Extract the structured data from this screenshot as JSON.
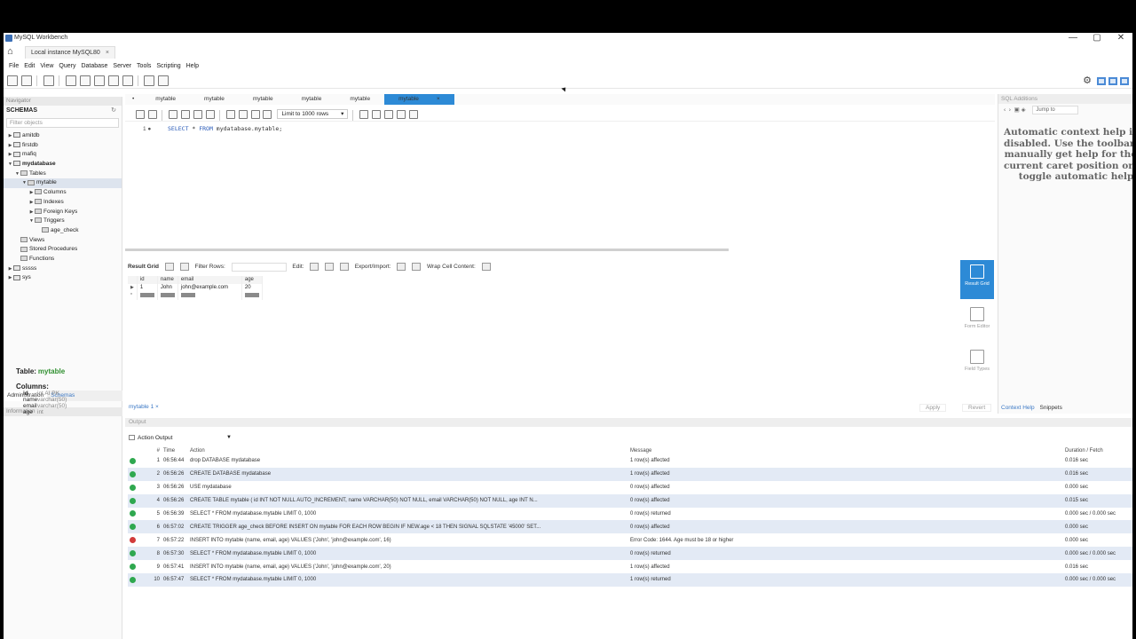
{
  "window": {
    "title": "MySQL Workbench",
    "controls": [
      "—",
      "▢",
      "✕"
    ]
  },
  "connection_tab": {
    "label": "Local instance MySQL80",
    "close": "×"
  },
  "menu": [
    "File",
    "Edit",
    "View",
    "Query",
    "Database",
    "Server",
    "Tools",
    "Scripting",
    "Help"
  ],
  "navigator": {
    "header": "Navigator",
    "schemas_title": "SCHEMAS",
    "refresh": "↻",
    "filter_placeholder": "Filter objects",
    "tree": [
      {
        "label": "amitdb",
        "level": 0,
        "arrow": "▶",
        "bold": false
      },
      {
        "label": "firstdb",
        "level": 0,
        "arrow": "▶",
        "bold": false
      },
      {
        "label": "mafiq",
        "level": 0,
        "arrow": "▶",
        "bold": false
      },
      {
        "label": "mydatabase",
        "level": 0,
        "arrow": "▼",
        "bold": true
      },
      {
        "label": "Tables",
        "level": 1,
        "arrow": "▼",
        "bold": false
      },
      {
        "label": "mytable",
        "level": 2,
        "arrow": "▼",
        "bold": false,
        "selected": true
      },
      {
        "label": "Columns",
        "level": 3,
        "arrow": "▶",
        "bold": false
      },
      {
        "label": "Indexes",
        "level": 3,
        "arrow": "▶",
        "bold": false
      },
      {
        "label": "Foreign Keys",
        "level": 3,
        "arrow": "▶",
        "bold": false
      },
      {
        "label": "Triggers",
        "level": 3,
        "arrow": "▼",
        "bold": false
      },
      {
        "label": "age_check",
        "level": 4,
        "arrow": "",
        "bold": false
      },
      {
        "label": "Views",
        "level": 1,
        "arrow": "",
        "bold": false
      },
      {
        "label": "Stored Procedures",
        "level": 1,
        "arrow": "",
        "bold": false
      },
      {
        "label": "Functions",
        "level": 1,
        "arrow": "",
        "bold": false
      },
      {
        "label": "sssss",
        "level": 0,
        "arrow": "▶",
        "bold": false
      },
      {
        "label": "sys",
        "level": 0,
        "arrow": "▶",
        "bold": false
      }
    ],
    "tabs": [
      "Administration",
      "Schemas"
    ],
    "info_header": "Information",
    "info": {
      "table_label": "Table:",
      "table_name": "mytable",
      "columns_label": "Columns:",
      "columns": [
        {
          "name": "id",
          "type": "int AI PK"
        },
        {
          "name": "name",
          "type": "varchar(50)"
        },
        {
          "name": "email",
          "type": "varchar(50)"
        },
        {
          "name": "age",
          "type": "int"
        }
      ]
    }
  },
  "editor": {
    "tabs": [
      "mytable",
      "mytable",
      "mytable",
      "mytable",
      "mytable",
      "mytable"
    ],
    "active_tab_close": "×",
    "limit": "Limit to 1000 rows",
    "line_no": "1",
    "sql_kw1": "SELECT",
    "sql_mid": " * ",
    "sql_kw2": "FROM",
    "sql_rest": " mydatabase.mytable;"
  },
  "result": {
    "result_grid_label": "Result Grid",
    "filter_rows_label": "Filter Rows:",
    "edit_label": "Edit:",
    "export_label": "Export/Import:",
    "wrap_label": "Wrap Cell Content:",
    "columns": [
      "id",
      "name",
      "email",
      "age"
    ],
    "rows": [
      [
        "1",
        "John",
        "john@example.com",
        "20"
      ]
    ],
    "side_buttons": [
      "Result Grid",
      "Form Editor",
      "Field Types"
    ],
    "bottom_tab": "mytable 1",
    "apply": "Apply",
    "revert": "Revert"
  },
  "additions": {
    "header": "SQL Additions",
    "jump_to": "Jump to",
    "help_lines": [
      "Automatic context help is",
      "disabled. Use the toolbar t",
      "manually get help for the",
      "current caret position or t",
      "toggle automatic help."
    ],
    "tabs": [
      "Context Help",
      "Snippets"
    ]
  },
  "output": {
    "header": "Output",
    "selector": "Action Output",
    "columns": [
      "#",
      "Time",
      "Action",
      "Message",
      "Duration / Fetch"
    ],
    "rows": [
      {
        "status": "ok",
        "num": "1",
        "time": "06:56:44",
        "action": "drop DATABASE mydatabase",
        "message": "1 row(s) affected",
        "duration": "0.016 sec"
      },
      {
        "status": "ok",
        "num": "2",
        "time": "06:56:26",
        "action": "CREATE DATABASE mydatabase",
        "message": "1 row(s) affected",
        "duration": "0.016 sec"
      },
      {
        "status": "ok",
        "num": "3",
        "time": "06:56:26",
        "action": "USE mydatabase",
        "message": "0 row(s) affected",
        "duration": "0.000 sec"
      },
      {
        "status": "ok",
        "num": "4",
        "time": "06:56:26",
        "action": "CREATE TABLE mytable (  id INT NOT NULL AUTO_INCREMENT,   name VARCHAR(50) NOT NULL,   email VARCHAR(50) NOT NULL,   age INT N...",
        "message": "0 row(s) affected",
        "duration": "0.015 sec"
      },
      {
        "status": "ok",
        "num": "5",
        "time": "06:56:39",
        "action": "SELECT * FROM mydatabase.mytable LIMIT 0, 1000",
        "message": "0 row(s) returned",
        "duration": "0.000 sec / 0.000 sec"
      },
      {
        "status": "ok",
        "num": "6",
        "time": "06:57:02",
        "action": "CREATE TRIGGER age_check BEFORE INSERT ON mytable FOR EACH ROW BEGIN   IF NEW.age < 18 THEN     SIGNAL SQLSTATE '45000' SET...",
        "message": "0 row(s) affected",
        "duration": "0.000 sec"
      },
      {
        "status": "err",
        "num": "7",
        "time": "06:57:22",
        "action": "INSERT INTO mytable (name, email, age) VALUES ('John', 'john@example.com', 16)",
        "message": "Error Code: 1644. Age must be 18 or higher",
        "duration": "0.000 sec"
      },
      {
        "status": "ok",
        "num": "8",
        "time": "06:57:30",
        "action": "SELECT * FROM mydatabase.mytable LIMIT 0, 1000",
        "message": "0 row(s) returned",
        "duration": "0.000 sec / 0.000 sec"
      },
      {
        "status": "ok",
        "num": "9",
        "time": "06:57:41",
        "action": "INSERT INTO mytable (name, email, age) VALUES ('John', 'john@example.com', 20)",
        "message": "1 row(s) affected",
        "duration": "0.016 sec"
      },
      {
        "status": "ok",
        "num": "10",
        "time": "06:57:47",
        "action": "SELECT * FROM mydatabase.mytable LIMIT 0, 1000",
        "message": "1 row(s) returned",
        "duration": "0.000 sec / 0.000 sec"
      }
    ]
  },
  "colors": {
    "accent": "#2d8ad6",
    "success": "#2fa84f",
    "error": "#d23b3b",
    "table_name": "#2f8f2f"
  }
}
